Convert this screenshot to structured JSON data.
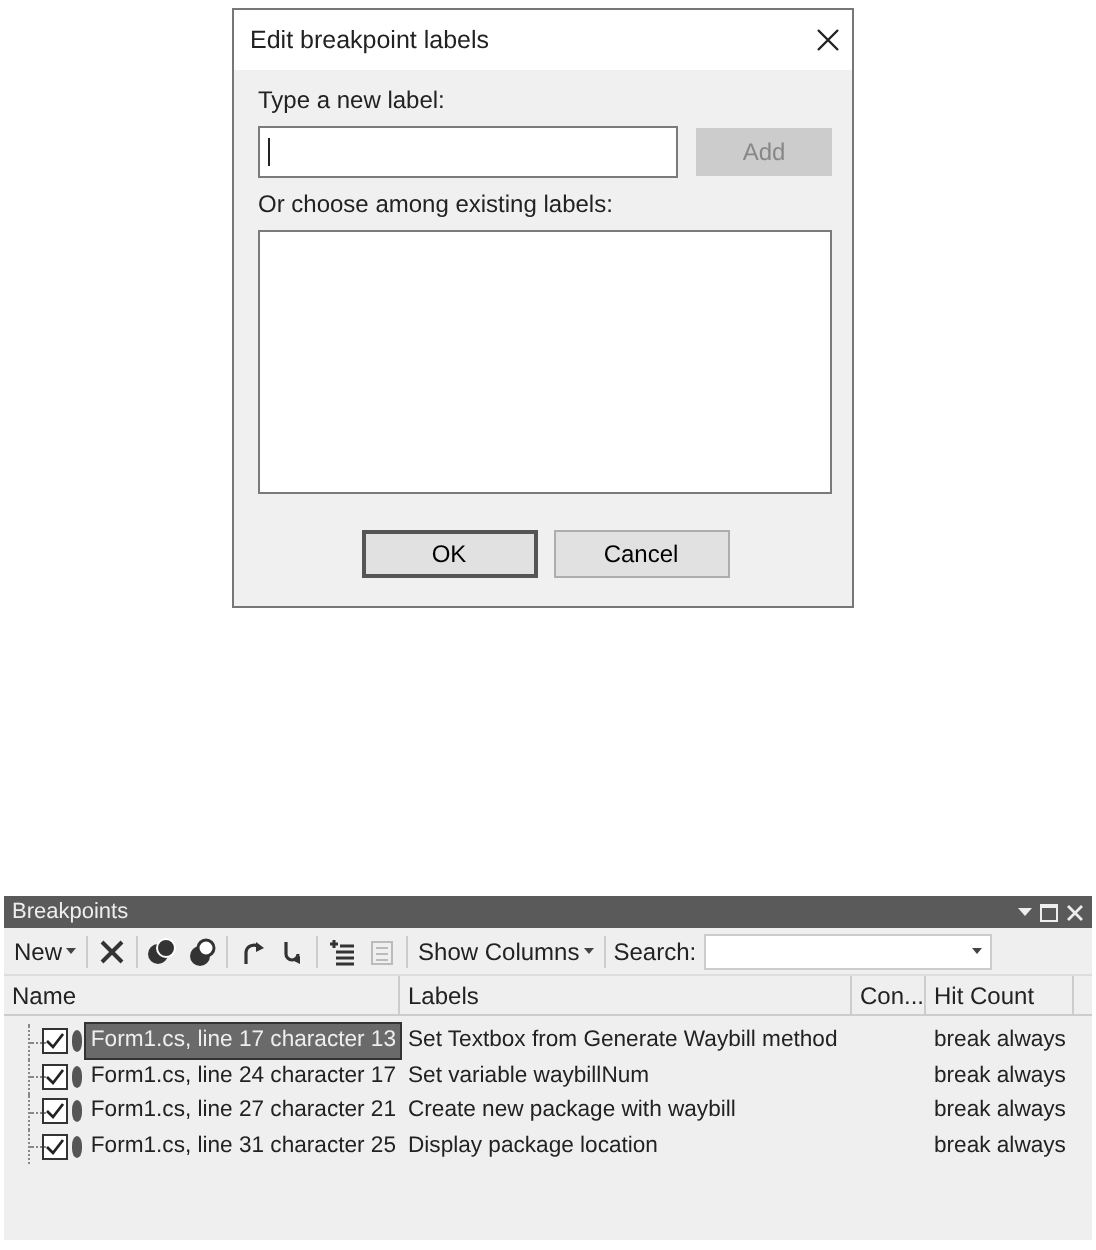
{
  "dialog": {
    "title": "Edit breakpoint labels",
    "new_label_caption": "Type a new label:",
    "add_button": {
      "label": "Add",
      "disabled": true
    },
    "existing_caption": "Or choose among existing labels:",
    "buttons": [
      {
        "label": "OK",
        "default": true
      },
      {
        "label": "Cancel",
        "default": false
      }
    ]
  },
  "panel": {
    "title": "Breakpoints",
    "toolbar": {
      "new_label": "New",
      "show_columns_label": "Show Columns",
      "search_label": "Search:",
      "tools": [
        {
          "kind": "delete",
          "disabled": false
        },
        {
          "kind": "toggle_all",
          "disabled": false
        },
        {
          "kind": "toggle_bp",
          "disabled": false
        },
        {
          "kind": "go_source",
          "disabled": false
        },
        {
          "kind": "go_disasm",
          "disabled": false
        },
        {
          "kind": "import",
          "disabled": false
        },
        {
          "kind": "export",
          "disabled": true
        }
      ]
    },
    "columns": [
      "Name",
      "Labels",
      "Con...",
      "Hit Count"
    ],
    "rows": [
      {
        "name": "Form1.cs, line 17 character 13",
        "labels": "Set Textbox from Generate Waybill method",
        "hit_count": "break always",
        "checked": true,
        "selected": true
      },
      {
        "name": "Form1.cs, line 24 character 17",
        "labels": "Set variable waybillNum",
        "hit_count": "break always",
        "checked": true,
        "selected": false
      },
      {
        "name": "Form1.cs, line 27 character 21",
        "labels": "Create new package with waybill",
        "hit_count": "break always",
        "checked": true,
        "selected": false
      },
      {
        "name": "Form1.cs, line 31 character 25",
        "labels": "Display package location",
        "hit_count": "break always",
        "checked": true,
        "selected": false
      }
    ]
  }
}
